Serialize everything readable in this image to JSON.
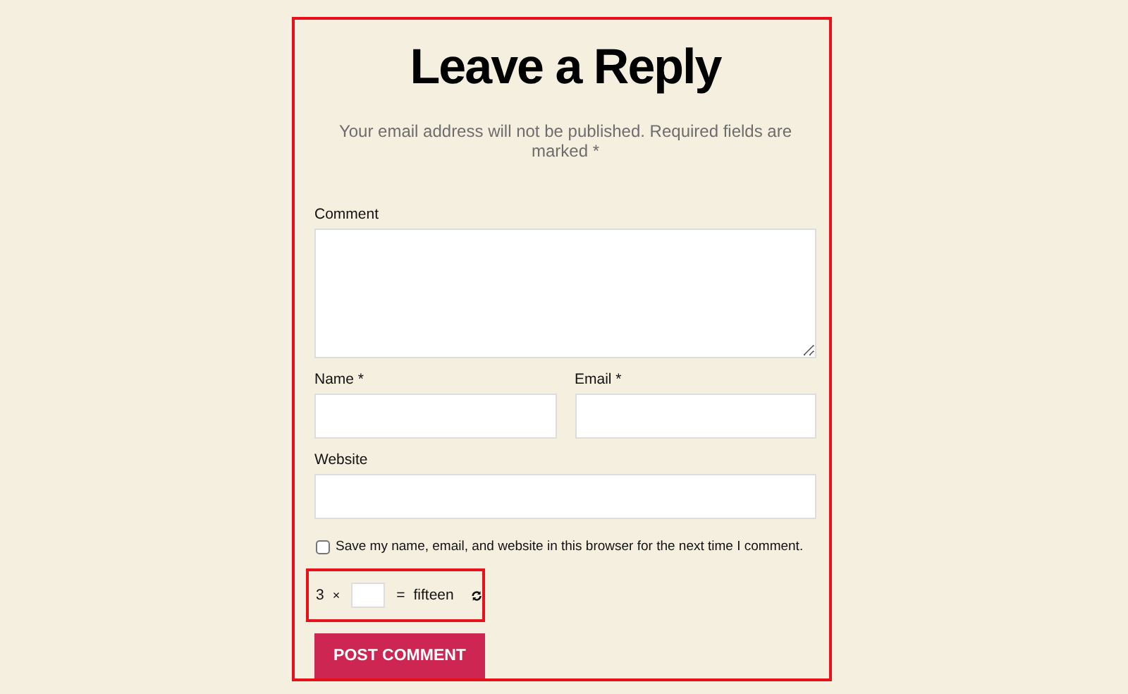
{
  "title": "Leave a Reply",
  "notice": "Your email address will not be published. Required fields are marked *",
  "fields": [
    {
      "label": "Comment",
      "kind": "textarea"
    },
    {
      "label": "Name *",
      "kind": "half"
    },
    {
      "label": "Email *",
      "kind": "half"
    },
    {
      "label": "Website",
      "kind": "full"
    }
  ],
  "consent": {
    "label": "Save my name, email, and website in this browser for the next time I comment.",
    "checked": false
  },
  "captcha": {
    "operand": "3",
    "operator": "×",
    "equals": "=",
    "result": "fifteen"
  },
  "submit": "POST COMMENT"
}
